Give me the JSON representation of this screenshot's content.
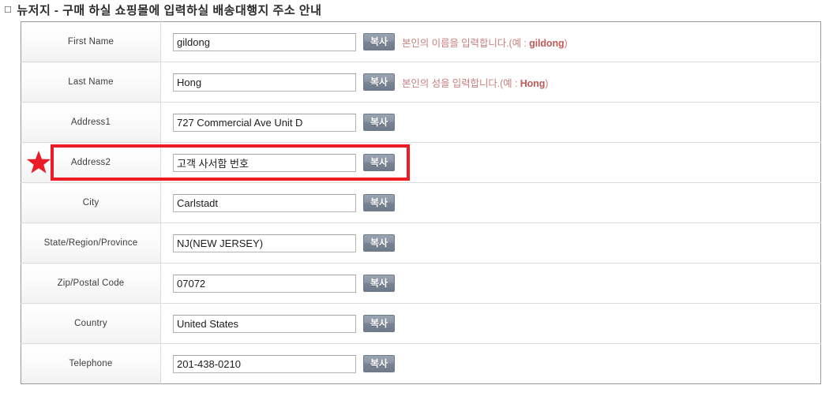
{
  "heading": {
    "bullet": "□",
    "title": "뉴저지 - 구매 하실 쇼핑몰에 입력하실 배송대행지 주소 안내"
  },
  "table": {
    "copy_button_label": "복사",
    "rows": [
      {
        "label": "First Name",
        "value": "gildong",
        "hint_prefix": "본인의 이름을 입력합니다.(예 : ",
        "hint_example": "gildong",
        "hint_suffix": ")"
      },
      {
        "label": "Last Name",
        "value": "Hong",
        "hint_prefix": "본인의 성을 입력합니다.(예 : ",
        "hint_example": "Hong",
        "hint_suffix": ")"
      },
      {
        "label": "Address1",
        "value": "727 Commercial Ave Unit D",
        "hint_prefix": "",
        "hint_example": "",
        "hint_suffix": ""
      },
      {
        "label": "Address2",
        "value": "고객 사서함 번호",
        "hint_prefix": "",
        "hint_example": "",
        "hint_suffix": ""
      },
      {
        "label": "City",
        "value": "Carlstadt",
        "hint_prefix": "",
        "hint_example": "",
        "hint_suffix": ""
      },
      {
        "label": "State/Region/Province",
        "value": "NJ(NEW JERSEY)",
        "hint_prefix": "",
        "hint_example": "",
        "hint_suffix": ""
      },
      {
        "label": "Zip/Postal Code",
        "value": "07072",
        "hint_prefix": "",
        "hint_example": "",
        "hint_suffix": ""
      },
      {
        "label": "Country",
        "value": "United States",
        "hint_prefix": "",
        "hint_example": "",
        "hint_suffix": ""
      },
      {
        "label": "Telephone",
        "value": "201-438-0210",
        "hint_prefix": "",
        "hint_example": "",
        "hint_suffix": ""
      }
    ]
  },
  "annotations": {
    "highlight_color": "#ee1c22",
    "star_color": "#e81d25",
    "highlighted_row_label": "Address2"
  }
}
